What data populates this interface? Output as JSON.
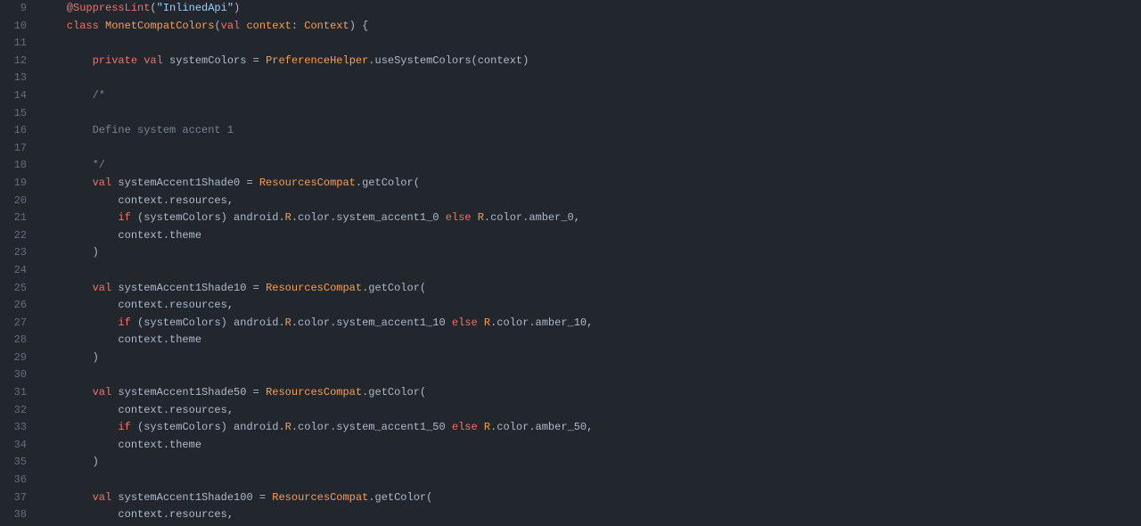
{
  "startLine": 9,
  "lines": [
    [
      {
        "i": 1,
        "c": "tok-at",
        "t": "@SuppressLint"
      },
      {
        "c": "tok-plain",
        "t": "("
      },
      {
        "c": "tok-str",
        "t": "\"InlinedApi\""
      },
      {
        "c": "tok-plain",
        "t": ")"
      }
    ],
    [
      {
        "i": 1,
        "c": "tok-kw",
        "t": "class"
      },
      {
        "c": "tok-plain",
        "t": " "
      },
      {
        "c": "tok-type",
        "t": "MonetCompatColors"
      },
      {
        "c": "tok-plain",
        "t": "("
      },
      {
        "c": "tok-kw",
        "t": "val"
      },
      {
        "c": "tok-plain",
        "t": " "
      },
      {
        "c": "tok-type",
        "t": "context"
      },
      {
        "c": "tok-plain",
        "t": ": "
      },
      {
        "c": "tok-type",
        "t": "Context"
      },
      {
        "c": "tok-plain",
        "t": ") {"
      }
    ],
    [],
    [
      {
        "i": 2,
        "c": "tok-kw",
        "t": "private"
      },
      {
        "c": "tok-plain",
        "t": " "
      },
      {
        "c": "tok-kw",
        "t": "val"
      },
      {
        "c": "tok-plain",
        "t": " systemColors "
      },
      {
        "c": "tok-plain",
        "t": "="
      },
      {
        "c": "tok-plain",
        "t": " "
      },
      {
        "c": "tok-type",
        "t": "PreferenceHelper"
      },
      {
        "c": "tok-plain",
        "t": ".useSystemColors(context)"
      }
    ],
    [],
    [
      {
        "i": 2,
        "c": "tok-cmt",
        "t": "/*"
      }
    ],
    [],
    [
      {
        "i": 2,
        "c": "tok-cmt",
        "t": "Define system accent 1"
      }
    ],
    [],
    [
      {
        "i": 2,
        "c": "tok-cmt",
        "t": "*/"
      }
    ],
    [
      {
        "i": 2,
        "c": "tok-kw",
        "t": "val"
      },
      {
        "c": "tok-plain",
        "t": " systemAccent1Shade0 "
      },
      {
        "c": "tok-plain",
        "t": "="
      },
      {
        "c": "tok-plain",
        "t": " "
      },
      {
        "c": "tok-type",
        "t": "ResourcesCompat"
      },
      {
        "c": "tok-plain",
        "t": ".getColor("
      }
    ],
    [
      {
        "i": 3,
        "c": "tok-plain",
        "t": "context.resources,"
      }
    ],
    [
      {
        "i": 3,
        "c": "tok-kw",
        "t": "if"
      },
      {
        "c": "tok-plain",
        "t": " (systemColors) android."
      },
      {
        "c": "tok-type",
        "t": "R"
      },
      {
        "c": "tok-plain",
        "t": ".color.system_accent1_0 "
      },
      {
        "c": "tok-kw",
        "t": "else"
      },
      {
        "c": "tok-plain",
        "t": " "
      },
      {
        "c": "tok-type",
        "t": "R"
      },
      {
        "c": "tok-plain",
        "t": ".color.amber_0,"
      }
    ],
    [
      {
        "i": 3,
        "c": "tok-plain",
        "t": "context.theme"
      }
    ],
    [
      {
        "i": 2,
        "c": "tok-plain",
        "t": ")"
      }
    ],
    [],
    [
      {
        "i": 2,
        "c": "tok-kw",
        "t": "val"
      },
      {
        "c": "tok-plain",
        "t": " systemAccent1Shade10 "
      },
      {
        "c": "tok-plain",
        "t": "="
      },
      {
        "c": "tok-plain",
        "t": " "
      },
      {
        "c": "tok-type",
        "t": "ResourcesCompat"
      },
      {
        "c": "tok-plain",
        "t": ".getColor("
      }
    ],
    [
      {
        "i": 3,
        "c": "tok-plain",
        "t": "context.resources,"
      }
    ],
    [
      {
        "i": 3,
        "c": "tok-kw",
        "t": "if"
      },
      {
        "c": "tok-plain",
        "t": " (systemColors) android."
      },
      {
        "c": "tok-type",
        "t": "R"
      },
      {
        "c": "tok-plain",
        "t": ".color.system_accent1_10 "
      },
      {
        "c": "tok-kw",
        "t": "else"
      },
      {
        "c": "tok-plain",
        "t": " "
      },
      {
        "c": "tok-type",
        "t": "R"
      },
      {
        "c": "tok-plain",
        "t": ".color.amber_10,"
      }
    ],
    [
      {
        "i": 3,
        "c": "tok-plain",
        "t": "context.theme"
      }
    ],
    [
      {
        "i": 2,
        "c": "tok-plain",
        "t": ")"
      }
    ],
    [],
    [
      {
        "i": 2,
        "c": "tok-kw",
        "t": "val"
      },
      {
        "c": "tok-plain",
        "t": " systemAccent1Shade50 "
      },
      {
        "c": "tok-plain",
        "t": "="
      },
      {
        "c": "tok-plain",
        "t": " "
      },
      {
        "c": "tok-type",
        "t": "ResourcesCompat"
      },
      {
        "c": "tok-plain",
        "t": ".getColor("
      }
    ],
    [
      {
        "i": 3,
        "c": "tok-plain",
        "t": "context.resources,"
      }
    ],
    [
      {
        "i": 3,
        "c": "tok-kw",
        "t": "if"
      },
      {
        "c": "tok-plain",
        "t": " (systemColors) android."
      },
      {
        "c": "tok-type",
        "t": "R"
      },
      {
        "c": "tok-plain",
        "t": ".color.system_accent1_50 "
      },
      {
        "c": "tok-kw",
        "t": "else"
      },
      {
        "c": "tok-plain",
        "t": " "
      },
      {
        "c": "tok-type",
        "t": "R"
      },
      {
        "c": "tok-plain",
        "t": ".color.amber_50,"
      }
    ],
    [
      {
        "i": 3,
        "c": "tok-plain",
        "t": "context.theme"
      }
    ],
    [
      {
        "i": 2,
        "c": "tok-plain",
        "t": ")"
      }
    ],
    [],
    [
      {
        "i": 2,
        "c": "tok-kw",
        "t": "val"
      },
      {
        "c": "tok-plain",
        "t": " systemAccent1Shade100 "
      },
      {
        "c": "tok-plain",
        "t": "="
      },
      {
        "c": "tok-plain",
        "t": " "
      },
      {
        "c": "tok-type",
        "t": "ResourcesCompat"
      },
      {
        "c": "tok-plain",
        "t": ".getColor("
      }
    ],
    [
      {
        "i": 3,
        "c": "tok-plain",
        "t": "context.resources,"
      }
    ]
  ]
}
